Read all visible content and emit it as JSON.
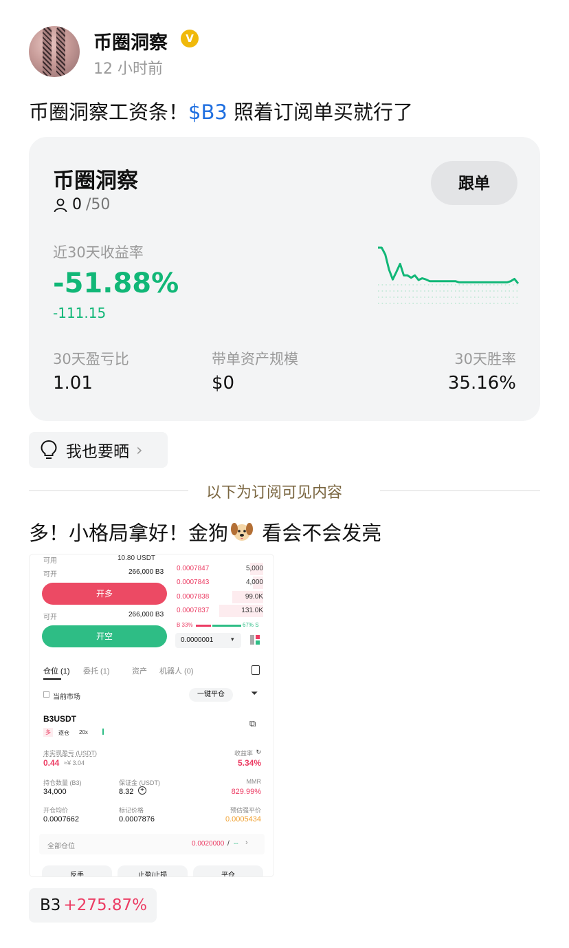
{
  "post": {
    "author": "币圈洞察",
    "timestamp": "12 小时前",
    "text_before": "币圈洞察工资条！",
    "ticker": "$B3",
    "text_after": " 照着订阅单买就行了"
  },
  "card": {
    "title": "币圈洞察",
    "follow_label": "跟单",
    "followers_current": "0",
    "followers_max": "/50",
    "roi_label": "近30天收益率",
    "roi_value": "-51.88%",
    "roi_sub": "-111.15",
    "stats": [
      {
        "label": "30天盈亏比",
        "value": "1.01"
      },
      {
        "label": "带单资产规模",
        "value": "$0"
      },
      {
        "label": "30天胜率",
        "value": "35.16%"
      }
    ],
    "colors": {
      "positive": "#11b777",
      "negative": "#ec3c63",
      "ticker": "#1f6fe0"
    }
  },
  "share_label": "我也要晒",
  "divider_text": "以下为订阅可见内容",
  "post2": {
    "text_before": "多！小格局拿好！金狗",
    "text_after": " 看会不会发亮"
  },
  "screenshot": {
    "available_label": "可用",
    "available_value": "10.80 USDT",
    "open_label": "可开",
    "open_value": "266,000 B3",
    "long_button": "开多",
    "short_button": "开空",
    "orderbook": [
      {
        "price": "0.0007847",
        "qty": "5,000",
        "depth": 0.15
      },
      {
        "price": "0.0007843",
        "qty": "4,000",
        "depth": 0.12
      },
      {
        "price": "0.0007838",
        "qty": "99.0K",
        "depth": 0.35
      },
      {
        "price": "0.0007837",
        "qty": "131.0K",
        "depth": 0.5
      }
    ],
    "buy_ratio": "B 33%",
    "sell_ratio": "67% S",
    "tick_size": "0.0000001",
    "tabs": [
      "仓位 (1)",
      "委托 (1)",
      "资产",
      "机器人 (0)"
    ],
    "current_market": "当前市场",
    "close_all": "一键平仓",
    "symbol": "B3USDT",
    "side": "多",
    "margin_mode": "逐仓",
    "leverage": "20x",
    "unrealized_label": "未实现盈亏 (USDT)",
    "unrealized_value": "0.44",
    "unrealized_cny": "≈¥ 3.04",
    "roe_label": "收益率",
    "roe_value": "5.34%",
    "size_label": "持仓数量 (B3)",
    "size_value": "34,000",
    "margin_label": "保证金 (USDT)",
    "margin_value": "8.32",
    "mmr_label": "MMR",
    "mmr_value": "829.99%",
    "entry_label": "开仓均价",
    "entry_value": "0.0007662",
    "mark_label": "标记价格",
    "mark_value": "0.0007876",
    "liq_label": "预估强平价",
    "liq_value": "0.0005434",
    "all_position": "全部仓位",
    "tp_value": "0.0020000",
    "sl_value": "--",
    "bottom_buttons": [
      "反手",
      "止盈/止损",
      "平仓"
    ]
  },
  "bottom_ticker": {
    "symbol": "B3",
    "change": "+275.87%"
  },
  "chart_data": {
    "type": "line",
    "series": [
      {
        "values": [
          100,
          100,
          88,
          62,
          45,
          58,
          72,
          52,
          52,
          48,
          52,
          44,
          47,
          45,
          42,
          42,
          42,
          42,
          42,
          42,
          42,
          42,
          40,
          40,
          40,
          40,
          40,
          40,
          40,
          40,
          40,
          40,
          40,
          40,
          40,
          40,
          42,
          46,
          38
        ]
      }
    ],
    "title": "",
    "xlabel": "",
    "ylabel": ""
  }
}
